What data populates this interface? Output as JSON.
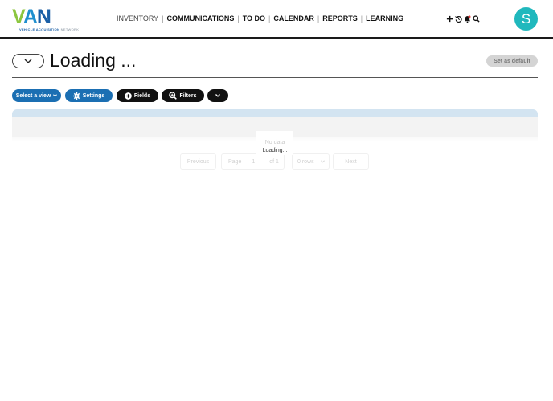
{
  "header": {
    "logo": {
      "letters": [
        "V",
        "A",
        "N"
      ],
      "tagline_bold": "VEHICLE ACQUISITION",
      "tagline_light": "NETWORK"
    },
    "nav": [
      {
        "label": "INVENTORY",
        "active": true
      },
      {
        "label": "COMMUNICATIONS"
      },
      {
        "label": "TO DO"
      },
      {
        "label": "CALENDAR"
      },
      {
        "label": "REPORTS"
      },
      {
        "label": "LEARNING"
      }
    ],
    "separator": "|",
    "tools": [
      "plus-icon",
      "history-icon",
      "bell-icon",
      "search-icon"
    ],
    "avatar_initial": "S",
    "avatar_color": "#20b8bd"
  },
  "title_row": {
    "title": "Loading ...",
    "set_default_label": "Set as default"
  },
  "toolbar": {
    "select_view_label": "Select a view",
    "settings_label": "Settings",
    "fields_label": "Fields",
    "filters_label": "Filters"
  },
  "table": {
    "no_data": "No data",
    "loading": "Loading...",
    "pagination": {
      "previous": "Previous",
      "page_label": "Page",
      "page_value": "1",
      "of_label": "of 1",
      "rows_value": "0 rows",
      "next": "Next"
    }
  },
  "colors": {
    "brand_blue": "#1b6fb3",
    "brand_green": "#8cc63f",
    "header_border": "#1a1a1a"
  }
}
